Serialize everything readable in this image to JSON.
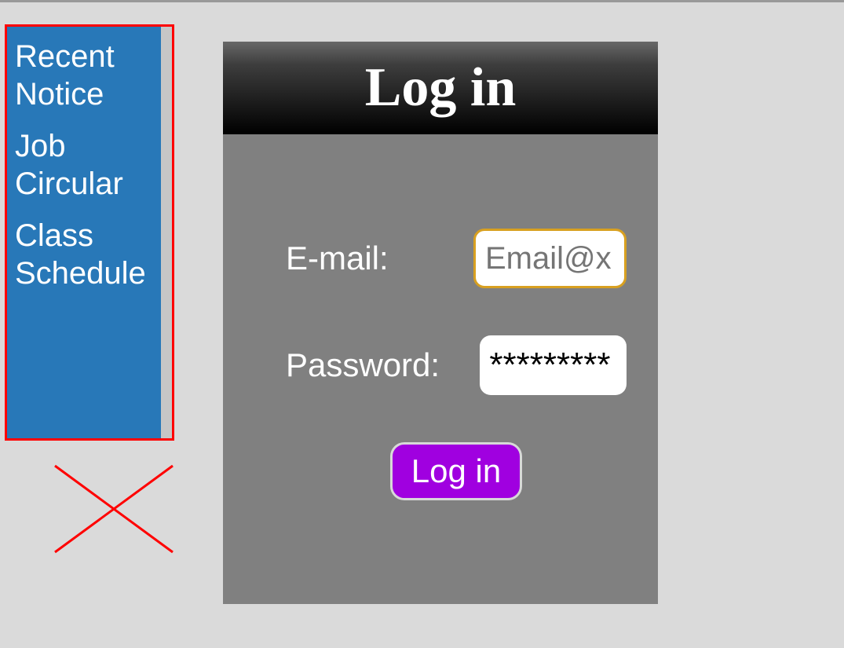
{
  "sidebar": {
    "items": [
      {
        "label": "Recent Notice"
      },
      {
        "label": "Job Circular"
      },
      {
        "label": "Class Schedule"
      }
    ]
  },
  "login": {
    "title": "Log in",
    "email_label": "E-mail:",
    "email_placeholder": "Email@x",
    "password_label": "Password:",
    "password_value": "*********",
    "button_label": "Log in"
  },
  "colors": {
    "sidebar_bg": "#2878b8",
    "sidebar_border": "#ff0000",
    "panel_bg": "#808080",
    "button_bg": "#a000e0",
    "close_x": "#ff0000"
  }
}
